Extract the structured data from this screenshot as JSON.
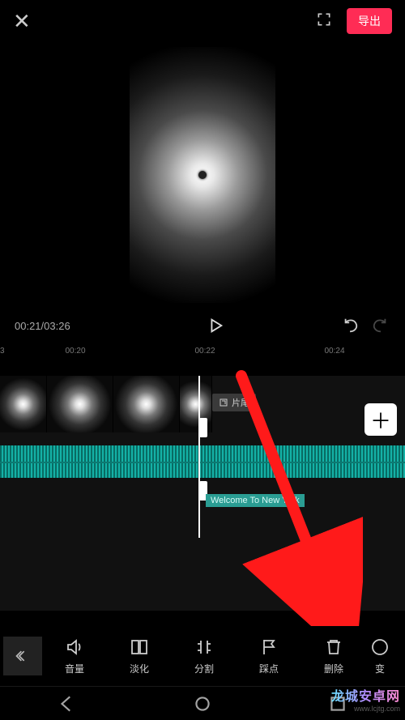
{
  "header": {
    "export_label": "导出"
  },
  "playback": {
    "current": "00:21",
    "total": "03:26"
  },
  "ruler": {
    "ticks": [
      "3",
      "00:20",
      "00:22",
      "00:24"
    ]
  },
  "timeline": {
    "tail_label": "片尾",
    "audio_title": "Welcome To New York"
  },
  "tools": {
    "t0": "音量",
    "t1": "淡化",
    "t2": "分割",
    "t3": "踩点",
    "t4": "删除",
    "t5": "变"
  },
  "watermark": {
    "cn": "龙城安卓网",
    "en": "www.lcjtg.com"
  }
}
